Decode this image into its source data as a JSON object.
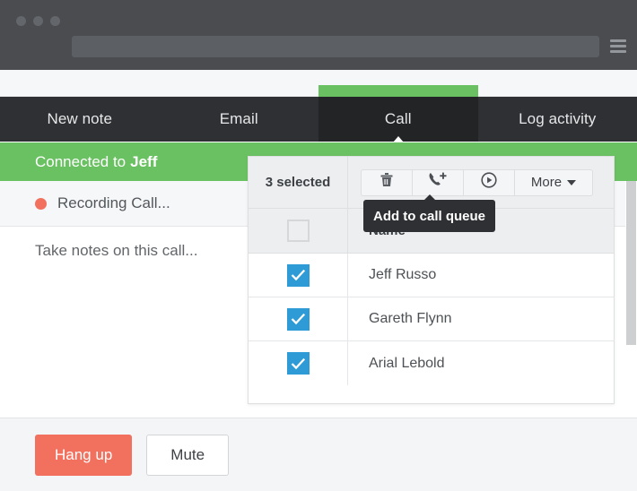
{
  "browser": {
    "window_controls": [
      "dot-1",
      "dot-2",
      "dot-3"
    ],
    "address_value": "",
    "address_placeholder": "",
    "menu_icon": "hamburger-menu-icon"
  },
  "tabs": [
    {
      "label": "New note",
      "active": false
    },
    {
      "label": "Email",
      "active": false
    },
    {
      "label": "Call",
      "active": true
    },
    {
      "label": "Log activity",
      "active": false
    }
  ],
  "call": {
    "banner_prefix": "Connected to",
    "banner_contact": "Jeff",
    "recording_status": "Recording Call...",
    "notes_placeholder": "Take notes on this call...",
    "hang_up_label": "Hang up",
    "mute_label": "Mute"
  },
  "panel": {
    "selected_count_label": "3 selected",
    "toolbar_buttons": [
      {
        "icon": "trash-icon",
        "label": ""
      },
      {
        "icon": "phone-add-icon",
        "label": ""
      },
      {
        "icon": "play-circle-icon",
        "label": ""
      }
    ],
    "more_label": "More",
    "tooltip_text": "Add to call queue",
    "table": {
      "columns": [
        "",
        "Name"
      ],
      "header_checkbox_checked": false,
      "rows": [
        {
          "checked": true,
          "name": "Jeff Russo"
        },
        {
          "checked": true,
          "name": "Gareth Flynn"
        },
        {
          "checked": true,
          "name": "Arial Lebold"
        }
      ]
    }
  },
  "colors": {
    "accent_green": "#6ac162",
    "danger_red": "#f2705e",
    "checkbox_blue": "#2f9bd6",
    "chrome_dark": "#4a4c50",
    "tabbar_dark": "#2e3033"
  }
}
